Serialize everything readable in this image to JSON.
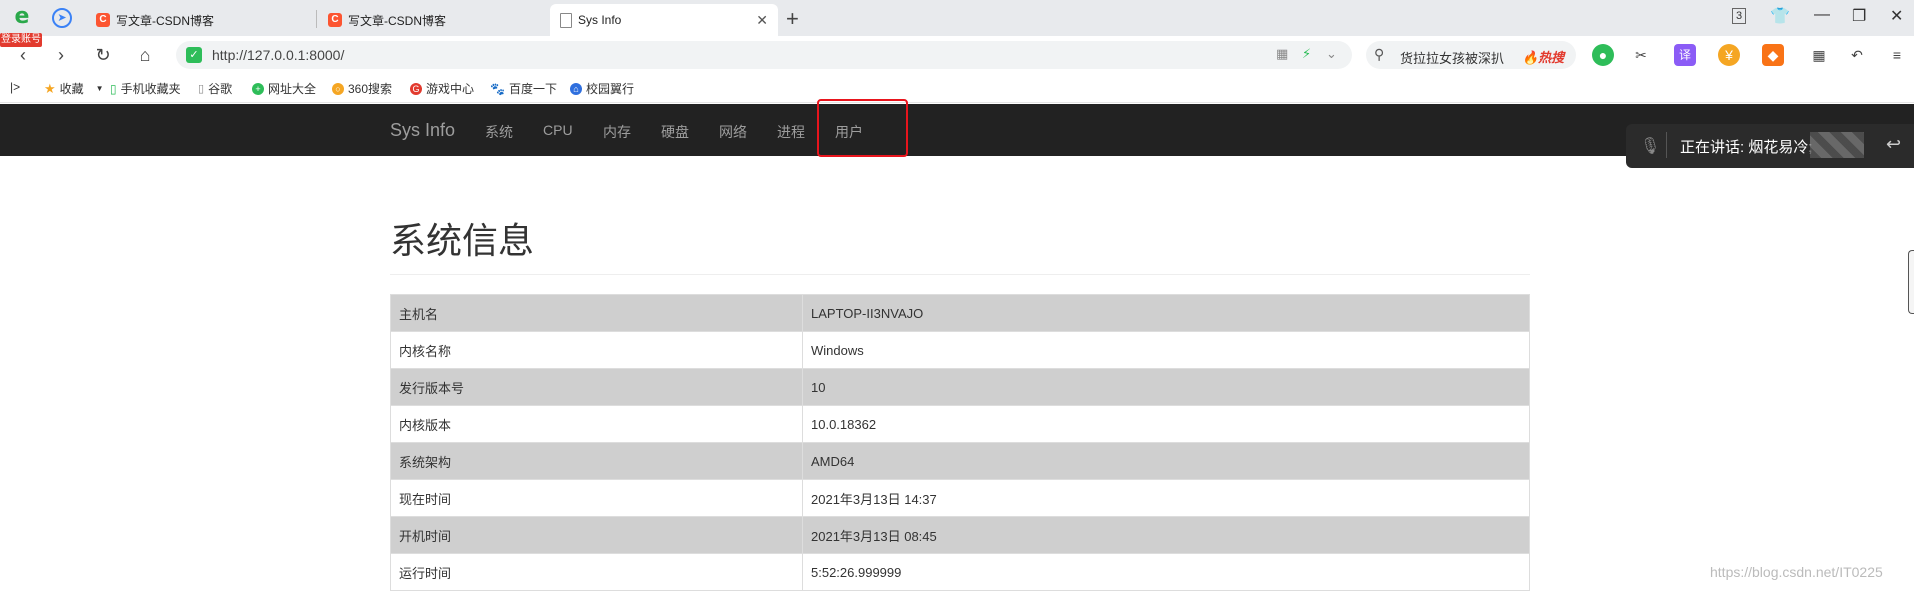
{
  "browser": {
    "login_badge": "登录账号",
    "tabs": [
      {
        "label": "写文章-CSDN博客",
        "favicon": "C"
      },
      {
        "label": "写文章-CSDN博客",
        "favicon": "C"
      },
      {
        "label": "Sys Info",
        "favicon": ""
      }
    ],
    "tab_count": "3",
    "url": "http://127.0.0.1:8000/",
    "search_text": "货拉拉女孩被深扒",
    "search_hot": "🔥热搜",
    "ext_translate": "译"
  },
  "bookmarks": [
    {
      "label": "收藏",
      "icon": "star-icon"
    },
    {
      "label": "手机收藏夹",
      "icon": "phone-icon"
    },
    {
      "label": "谷歌",
      "icon": "page-icon"
    },
    {
      "label": "网址大全",
      "icon": "globe-icon"
    },
    {
      "label": "360搜索",
      "icon": "search-icon"
    },
    {
      "label": "游戏中心",
      "icon": "game-icon"
    },
    {
      "label": "百度一下",
      "icon": "baidu-icon"
    },
    {
      "label": "校园翼行",
      "icon": "campus-icon"
    }
  ],
  "navbar": {
    "brand": "Sys Info",
    "links": [
      "系统",
      "CPU",
      "内存",
      "硬盘",
      "网络",
      "进程",
      "用户"
    ]
  },
  "voice": {
    "text": "正在讲话: 烟花易冷;"
  },
  "page": {
    "heading": "系统信息",
    "rows": [
      {
        "key": "主机名",
        "value": "LAPTOP-II3NVAJO"
      },
      {
        "key": "内核名称",
        "value": "Windows"
      },
      {
        "key": "发行版本号",
        "value": "10"
      },
      {
        "key": "内核版本",
        "value": "10.0.18362"
      },
      {
        "key": "系统架构",
        "value": "AMD64"
      },
      {
        "key": "现在时间",
        "value": "2021年3月13日 14:37"
      },
      {
        "key": "开机时间",
        "value": "2021年3月13日 08:45"
      },
      {
        "key": "运行时间",
        "value": "5:52:26.999999"
      }
    ]
  },
  "watermark": "https://blog.csdn.net/IT0225"
}
